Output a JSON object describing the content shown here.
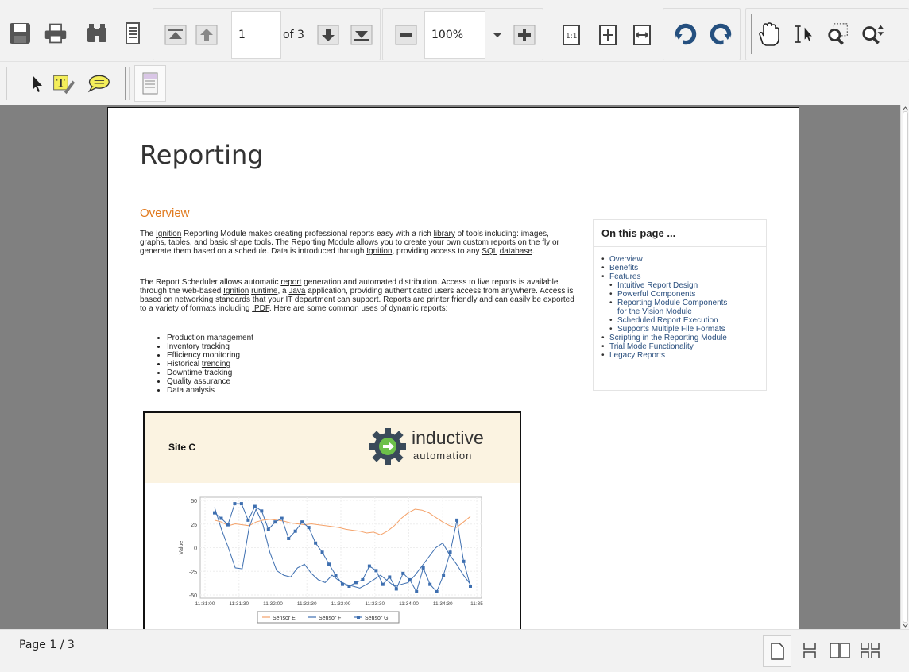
{
  "toolbar": {
    "page_input": "1",
    "of_pages": "of 3",
    "zoom": "100%"
  },
  "status": {
    "page_indicator": "Page 1 / 3"
  },
  "document": {
    "title": "Reporting",
    "overview_heading": "Overview",
    "p1_parts": [
      "The ",
      "Ignition",
      " Reporting Module makes creating professional reports easy with a rich ",
      "library",
      " of tools including: images, graphs, tables, and basic shape tools. The Reporting Module allows you to create your own custom reports on the fly or generate them based on a schedule. Data is introduced through ",
      "Ignition",
      ", providing access to any ",
      "SQL",
      " ",
      "database",
      "."
    ],
    "p2_parts": [
      "The Report Scheduler allows automatic ",
      "report",
      " generation and automated distribution.  Access to live reports is available through the web-based ",
      "Ignition",
      " ",
      "runtime",
      ", a ",
      "Java",
      " application, providing authenticated users access from anywhere. Access is based on networking standards that your IT department can support. Reports are printer friendly and can easily be exported to a variety of formats including ",
      ".PDF",
      ". Here are some common uses of dynamic reports:"
    ],
    "uses": [
      "Production management",
      "Inventory tracking",
      "Efficiency monitoring",
      "Historical trending",
      "Downtime tracking",
      "Quality assurance",
      "Data analysis"
    ],
    "toc_heading": "On this page ...",
    "toc_items": [
      {
        "label": "Overview",
        "level": 1
      },
      {
        "label": "Benefits",
        "level": 1
      },
      {
        "label": "Features",
        "level": 1
      },
      {
        "label": "Intuitive Report Design",
        "level": 2
      },
      {
        "label": "Powerful Components",
        "level": 2
      },
      {
        "label": "Reporting Module Components",
        "level": 2
      },
      {
        "label": "for the Vision Module",
        "level": 2,
        "continuation": true
      },
      {
        "label": "Scheduled Report Execution",
        "level": 2
      },
      {
        "label": "Supports Multiple File Formats",
        "level": 2
      },
      {
        "label": "Scripting in the Reporting Module",
        "level": 1
      },
      {
        "label": "Trial Mode Functionality",
        "level": 1
      },
      {
        "label": "Legacy Reports",
        "level": 1
      }
    ],
    "report": {
      "site": "Site C",
      "logo_line1": "inductive",
      "logo_line2": "automation"
    }
  },
  "chart_data": {
    "type": "line",
    "ylabel": "Value",
    "ylim": [
      -55,
      55
    ],
    "yticks": [
      "50",
      "25",
      "0",
      "-25",
      "-50"
    ],
    "xticks": [
      "11:31:00",
      "11:31:30",
      "11:32:00",
      "11:32:30",
      "11:33:00",
      "11:33:30",
      "11:34:00",
      "11:34:30",
      "11:35"
    ],
    "series": [
      {
        "name": "Sensor E",
        "color": "#f4a26a",
        "values": [
          30,
          28,
          24,
          26,
          25,
          24,
          28,
          30,
          31,
          30,
          29,
          27,
          26,
          25,
          26,
          25,
          24,
          23,
          22,
          20,
          19,
          18,
          16,
          17,
          14,
          18,
          24,
          32,
          38,
          42,
          41,
          38,
          33,
          28,
          24,
          22,
          28,
          34
        ]
      },
      {
        "name": "Sensor F",
        "color": "#3e6fb0",
        "values": [
          44,
          20,
          0,
          -22,
          -23,
          22,
          42,
          25,
          -5,
          -25,
          -30,
          -32,
          -22,
          -18,
          -28,
          -35,
          -38,
          -30,
          -36,
          -40,
          -42,
          -44,
          -40,
          -35,
          -30,
          -36,
          -42,
          -40,
          -38,
          -30,
          -20,
          -10,
          0,
          5,
          -8,
          -18,
          -30,
          -40
        ]
      },
      {
        "name": "Sensor G",
        "color": "#3e6fb0",
        "markers": true,
        "values": [
          38,
          32,
          25,
          48,
          48,
          30,
          45,
          40,
          20,
          28,
          32,
          10,
          18,
          28,
          22,
          5,
          -5,
          -18,
          -30,
          -40,
          -42,
          -38,
          -35,
          -20,
          -25,
          -40,
          -32,
          -45,
          -28,
          -35,
          -48,
          -22,
          -40,
          -48,
          -30,
          -5,
          30,
          -15,
          -42
        ]
      }
    ]
  }
}
